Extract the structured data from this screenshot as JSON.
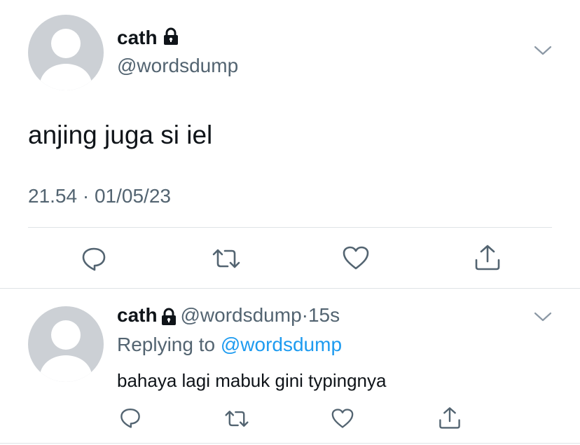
{
  "main_tweet": {
    "author_name": "cath",
    "author_handle": "@wordsdump",
    "text": "anjing juga si iel",
    "time": "21.54",
    "separator": "·",
    "date": "01/05/23",
    "icons": {
      "protected": "lock-icon",
      "menu": "chevron-down-icon",
      "reply": "reply-icon",
      "retweet": "retweet-icon",
      "like": "heart-icon",
      "share": "share-icon"
    }
  },
  "reply_tweet": {
    "author_name": "cath",
    "author_handle": "@wordsdump",
    "separator": "·",
    "time_ago": "15s",
    "replying_prefix": "Replying to",
    "replying_handle": "@wordsdump",
    "text": "bahaya lagi mabuk gini typingnya"
  },
  "colors": {
    "text": "#0f1419",
    "secondary": "#536471",
    "link": "#1d9bf0",
    "divider": "#dfe3e6",
    "avatar": "#ccd0d5"
  }
}
